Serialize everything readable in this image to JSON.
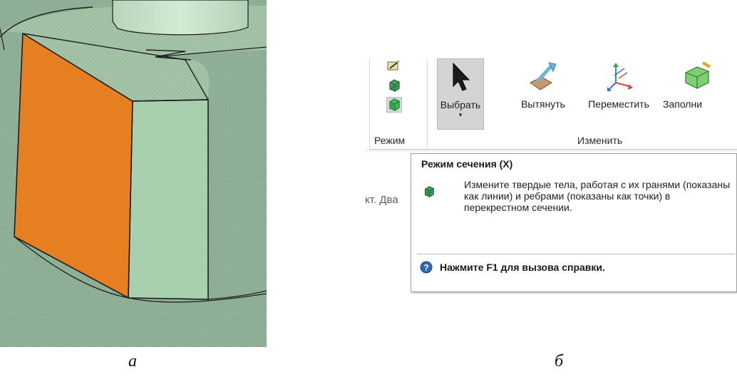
{
  "captions": {
    "left": "а",
    "right": "б"
  },
  "viewport": {
    "colors": {
      "cylinder_body": "#8fb097",
      "top_surface": "#a9c7ab",
      "selected_face": "#e67e22",
      "side_face": "#a8cfae",
      "upper_cylinder": "#c3dfc5",
      "edge": "#1d1d1d"
    }
  },
  "ribbon": {
    "mode_group_label": "Режим",
    "modify_group_label": "Изменить",
    "mode_icons": [
      "sketch-mode-icon",
      "section-mode-icon",
      "3d-mode-icon"
    ],
    "tools": [
      {
        "label": "Выбрать",
        "icon": "cursor-arrow-icon",
        "has_dropdown": true
      },
      {
        "label": "Вытянуть",
        "icon": "pull-icon"
      },
      {
        "label": "Переместить",
        "icon": "move-axes-icon"
      },
      {
        "label": "Заполни",
        "icon": "fill-icon"
      }
    ]
  },
  "document_tab_fragment": "кт. Два",
  "tooltip": {
    "title": "Режим сечения (X)",
    "icon": "section-mode-icon",
    "description": "Измените твердые тела, работая с их гранями (показаны как линии) и ребрами (показаны как точки) в перекрестном сечении.",
    "help": "Нажмите F1 для вызова справки."
  }
}
